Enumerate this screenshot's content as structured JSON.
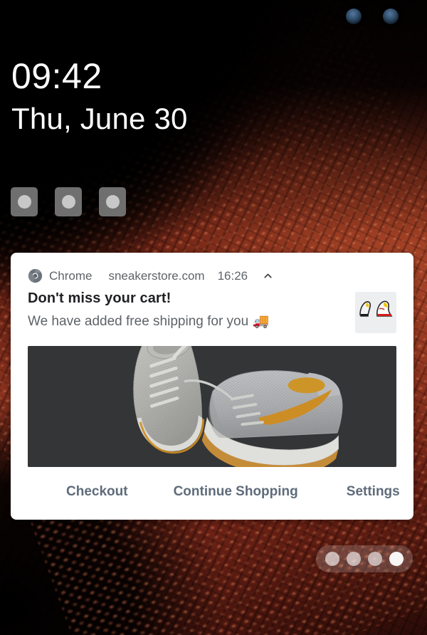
{
  "lockscreen": {
    "time": "09:42",
    "date": "Thu, June 30",
    "status_icons": [
      "camera-lens-icon",
      "camera-lens-icon"
    ],
    "quick_tiles": [
      {
        "name": "quick-tile-1"
      },
      {
        "name": "quick-tile-2"
      },
      {
        "name": "quick-tile-3"
      }
    ],
    "page_dots": {
      "count": 4,
      "active_index": 3
    }
  },
  "notification": {
    "app_name": "Chrome",
    "app_icon": "chrome-icon",
    "site": "sneakerstore.com",
    "time": "16:26",
    "collapse_icon": "chevron-up-icon",
    "title": "Don't miss your cart!",
    "subtitle": "We have added free shipping for you 🚚",
    "thumbnail_alt": "sneaker-pair-thumbnail",
    "hero_alt": "grey-knit-sneakers-hero-image",
    "actions": [
      {
        "label": "Checkout",
        "name": "checkout-action"
      },
      {
        "label": "Continue Shopping",
        "name": "continue-shopping-action"
      },
      {
        "label": "Settings",
        "name": "settings-action"
      }
    ]
  },
  "colors": {
    "card_bg": "#ffffff",
    "title": "#202124",
    "muted": "#5f6368",
    "action": "#5f6b7a",
    "accent_orange": "#e39b27",
    "wallpaper_red": "#8f3420"
  }
}
